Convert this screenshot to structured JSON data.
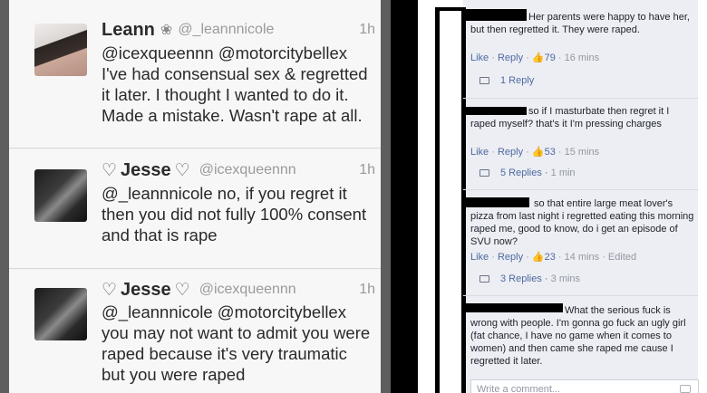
{
  "tweets": [
    {
      "name": "Leann",
      "handle": "@_leannnicole",
      "time": "1h",
      "text": "@icexqueennn @motorcitybellex I've had consensual sex & regretted it later. I thought I wanted to do it. Made a mistake. Wasn't rape at all."
    },
    {
      "name": "Jesse",
      "handle": "@icexqueennn",
      "time": "1h",
      "text": "@_leannnicole no, if you regret it then you did not fully 100% consent and that is rape"
    },
    {
      "name": "Jesse",
      "handle": "@icexqueennn",
      "time": "1h",
      "text": "@_leannnicole @motorcitybellex you may not want to admit you were raped because it's very traumatic but you were raped"
    }
  ],
  "comments": [
    {
      "text": "Her parents were happy to have her, but then regretted it. They were raped.",
      "like": "Like",
      "reply": "Reply",
      "likes": "79",
      "time": "16 mins",
      "edited": "",
      "replies_label": "1 Reply",
      "replies_time": ""
    },
    {
      "text": "so if I masturbate then regret it I raped myself? that's it I'm pressing charges",
      "like": "Like",
      "reply": "Reply",
      "likes": "53",
      "time": "15 mins",
      "edited": "",
      "replies_label": "5 Replies",
      "replies_time": "1 min"
    },
    {
      "text": "so that entire large meat lover's pizza from last night i regretted eating this morning raped me, good to know, do i get an episode of SVU now?",
      "like": "Like",
      "reply": "Reply",
      "likes": "23",
      "time": "14 mins",
      "edited": "Edited",
      "replies_label": "3 Replies",
      "replies_time": "3 mins"
    },
    {
      "text": "What the serious fuck is wrong with people. I'm gonna go fuck an ugly girl (fat chance, I have no game when it comes to women) and then came she raped me cause I regretted it later."
    }
  ],
  "write_comment_placeholder": "Write a comment...",
  "icons": {
    "heart": "♡",
    "flower": "❀",
    "thumbs_up": "👍",
    "camera": "camera-icon",
    "reply": "reply-icon"
  },
  "colors": {
    "fb_link": "#4e69a2",
    "fb_meta": "#9197a3",
    "tweet_meta": "#9a9a9a"
  }
}
